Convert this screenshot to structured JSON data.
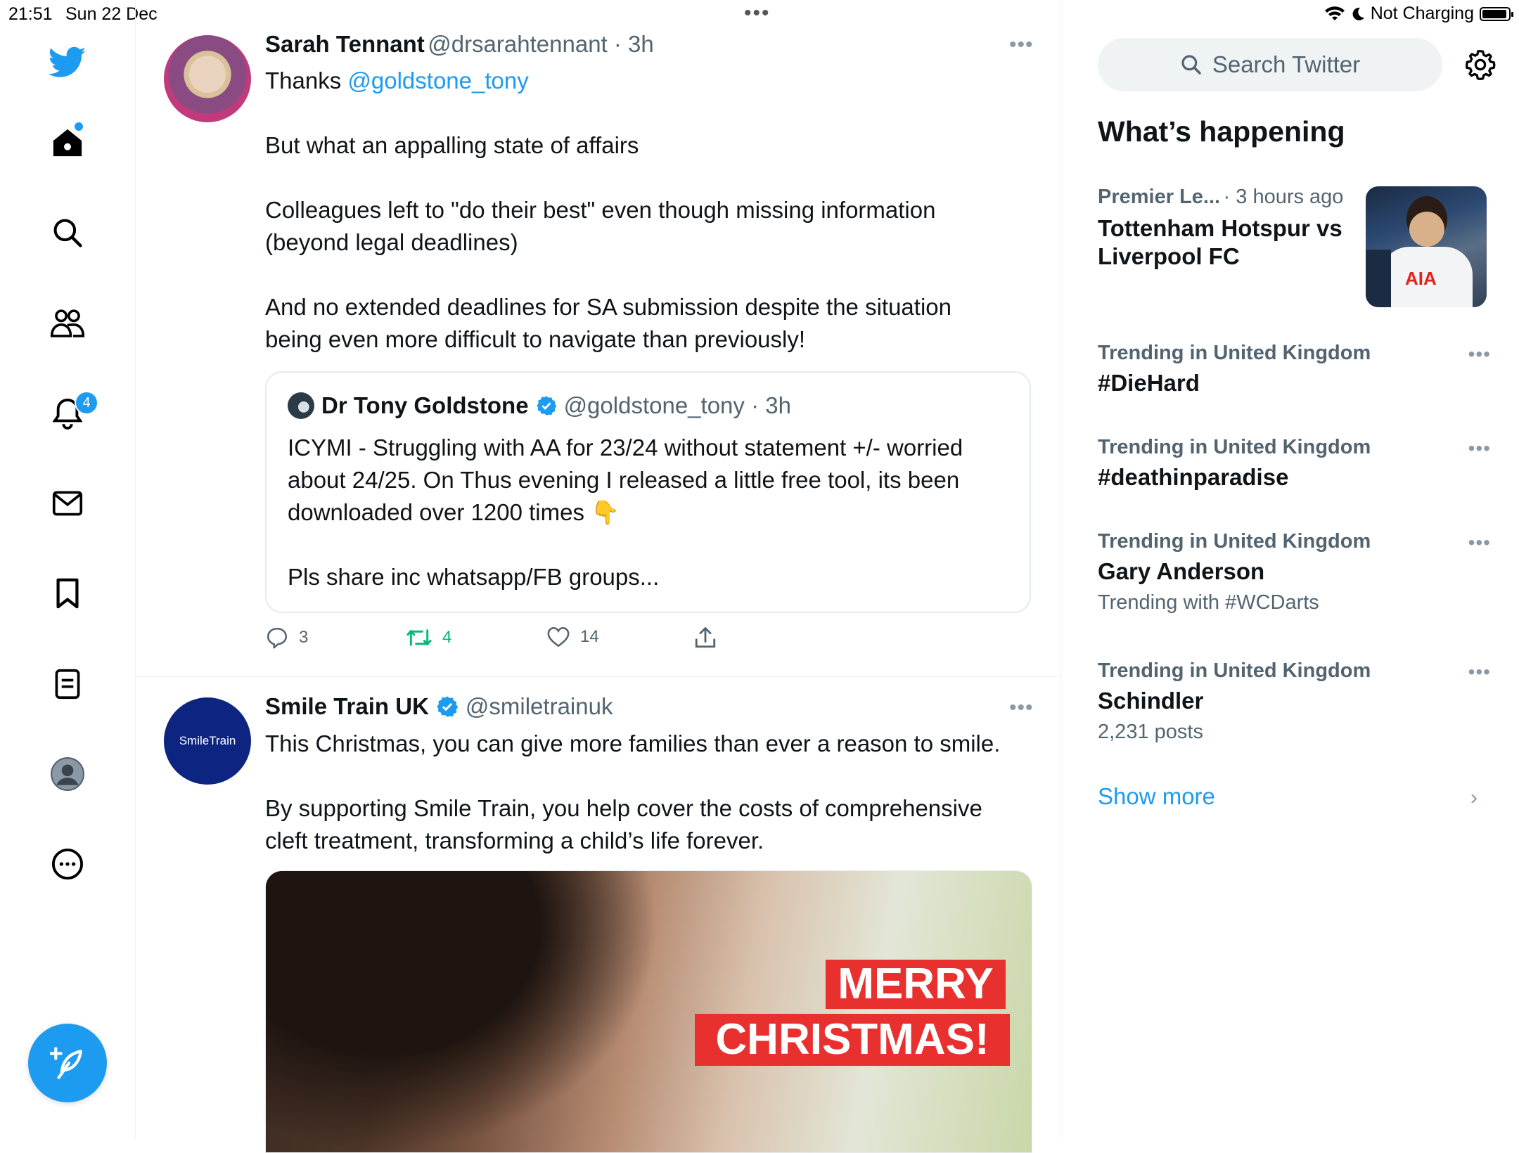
{
  "status_bar": {
    "time": "21:51",
    "date": "Sun 22 Dec",
    "charging": "Not Charging"
  },
  "nav": {
    "notifications_badge": "4"
  },
  "tweets": [
    {
      "name": "Sarah Tennant",
      "handle": "@drsarahtennant · 3h",
      "text_prefix": "Thanks ",
      "mention": "@goldstone_tony",
      "body": "But what an appalling state of affairs\n\nColleagues left to \"do their best\" even though missing information\n(beyond legal deadlines)\n\nAnd no extended deadlines for SA submission despite the situation\nbeing even more difficult to navigate than previously!",
      "quote": {
        "name": "Dr Tony Goldstone",
        "handle": "@goldstone_tony · 3h",
        "text": "ICYMI - Struggling with AA for 23/24 without statement +/- worried\nabout 24/25. On Thus evening I released a little free tool, its been\ndownloaded over 1200 times 👇\n\nPls share inc whatsapp/FB groups..."
      },
      "replies": "3",
      "retweets": "4",
      "likes": "14"
    },
    {
      "name": "Smile Train UK",
      "handle": "@smiletrainuk",
      "avatar_text": "SmileTrain",
      "body": "This Christmas, you can give more families than ever a reason to smile.\n\nBy supporting Smile Train, you help cover the costs of comprehensive\ncleft treatment, transforming a child’s life forever.",
      "media_line1": "MERRY",
      "media_line2": "CHRISTMAS!"
    }
  ],
  "sidebar": {
    "search_placeholder": "Search Twitter",
    "heading": "What’s happening",
    "featured": {
      "category": "Premier Le...",
      "time": "· 3 hours ago",
      "title": "Tottenham Hotspur vs\nLiverpool FC",
      "image_text": "AIA"
    },
    "trends": [
      {
        "meta": "Trending in United Kingdom",
        "name": "#DieHard",
        "sub": ""
      },
      {
        "meta": "Trending in United Kingdom",
        "name": "#deathinparadise",
        "sub": ""
      },
      {
        "meta": "Trending in United Kingdom",
        "name": "Gary Anderson",
        "sub": "Trending with #WCDarts"
      },
      {
        "meta": "Trending in United Kingdom",
        "name": "Schindler",
        "sub": "2,231 posts"
      }
    ],
    "show_more": "Show more"
  },
  "colors": {
    "accent": "#1d9bf0",
    "retweet": "#00ba7c",
    "text": "#0f1419",
    "secondary": "#536471"
  }
}
